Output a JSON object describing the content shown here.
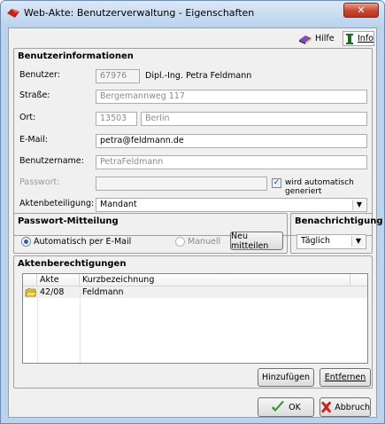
{
  "window": {
    "title": "Web-Akte: Benutzerverwaltung - Eigenschaften",
    "close_label": "✕"
  },
  "toolbar": {
    "hilfe": "Hilfe",
    "info": "Info"
  },
  "benutzer_group": {
    "title": "Benutzerinformationen",
    "benutzer_label": "Benutzer:",
    "benutzer_id": "67976",
    "benutzer_name": "Dipl.-Ing. Petra Feldmann",
    "strasse_label": "Straße:",
    "strasse_value": "Bergemannweg 117",
    "ort_label": "Ort:",
    "plz_value": "13503",
    "ort_value": "Berlin",
    "email_label": "E-Mail:",
    "email_value": "petra@feldmann.de",
    "benutzername_label": "Benutzername:",
    "benutzername_value": "PetraFeldmann",
    "passwort_label": "Passwort:",
    "passwort_value": "",
    "auto_generiert_label": "wird automatisch generiert",
    "auto_generiert_checked": true,
    "aktenbeteiligung_label": "Aktenbeteiligung:",
    "aktenbeteiligung_value": "Mandant"
  },
  "passwort_mitteilung": {
    "title": "Passwort-Mitteilung",
    "option_email": "Automatisch per E-Mail",
    "option_manuell": "Manuell",
    "selected": "email",
    "neu_mitteilen": "Neu mitteilen"
  },
  "benachrichtigung": {
    "title": "Benachrichtigung",
    "value": "Täglich"
  },
  "aktenberechtigungen": {
    "title": "Aktenberechtigungen",
    "columns": [
      "Akte",
      "Kurzbezeichnung"
    ],
    "rows": [
      {
        "akte": "42/08",
        "kurzbezeichnung": "Feldmann"
      }
    ],
    "hinzufuegen": "Hinzufügen",
    "entfernen": "Entfernen"
  },
  "footer": {
    "ok": "OK",
    "abbruch": "Abbruch"
  },
  "colors": {
    "titlebar_top": "#dbe8f7",
    "titlebar_bottom": "#bcd3ec",
    "close_red": "#c8452f",
    "client_bg": "#f0f0f0",
    "ok_check_green": "#2f9a2a",
    "cancel_x_red": "#c62a1e"
  }
}
